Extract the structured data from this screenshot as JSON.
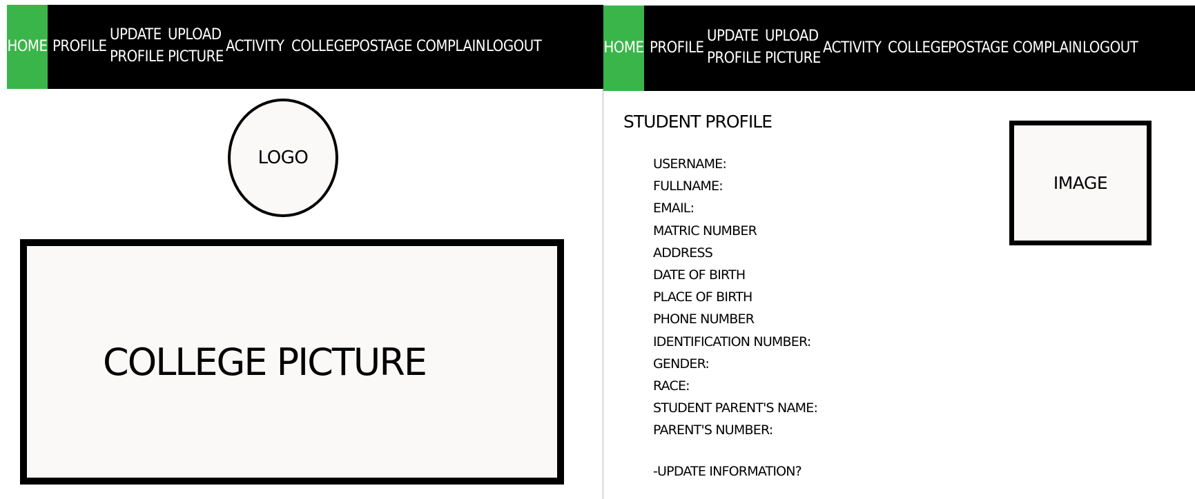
{
  "nav": {
    "items": [
      {
        "label": "HOME",
        "active": true
      },
      {
        "label": "PROFILE",
        "active": false
      },
      {
        "label": "UPDATE\nPROFILE",
        "line1": "UPDATE",
        "line2": "PROFILE",
        "active": false
      },
      {
        "label": "UPLOAD\nPICTURE",
        "line1": "UPLOAD",
        "line2": "PICTURE",
        "active": false
      },
      {
        "label": "ACTIVITY",
        "active": false
      },
      {
        "label": "COLLEGE",
        "active": false
      },
      {
        "label": "POSTAGE",
        "active": false
      },
      {
        "label": "COMPLAIN",
        "active": false
      },
      {
        "label": "LOGOUT",
        "active": false
      }
    ],
    "active_color": "#3ab54a",
    "bar_color": "#000000"
  },
  "home": {
    "logo_label": "LOGO",
    "college_picture_label": "COLLEGE PICTURE"
  },
  "profile": {
    "title": "STUDENT PROFILE",
    "fields": [
      "USERNAME:",
      "FULLNAME:",
      "EMAIL:",
      "MATRIC NUMBER",
      "ADDRESS",
      "DATE OF BIRTH",
      "PLACE OF BIRTH",
      "PHONE NUMBER",
      "IDENTIFICATION NUMBER:",
      "GENDER:",
      "RACE:",
      "STUDENT PARENT'S NAME:",
      "PARENT'S NUMBER:"
    ],
    "update_link": "-UPDATE INFORMATION?",
    "image_label": "IMAGE"
  }
}
